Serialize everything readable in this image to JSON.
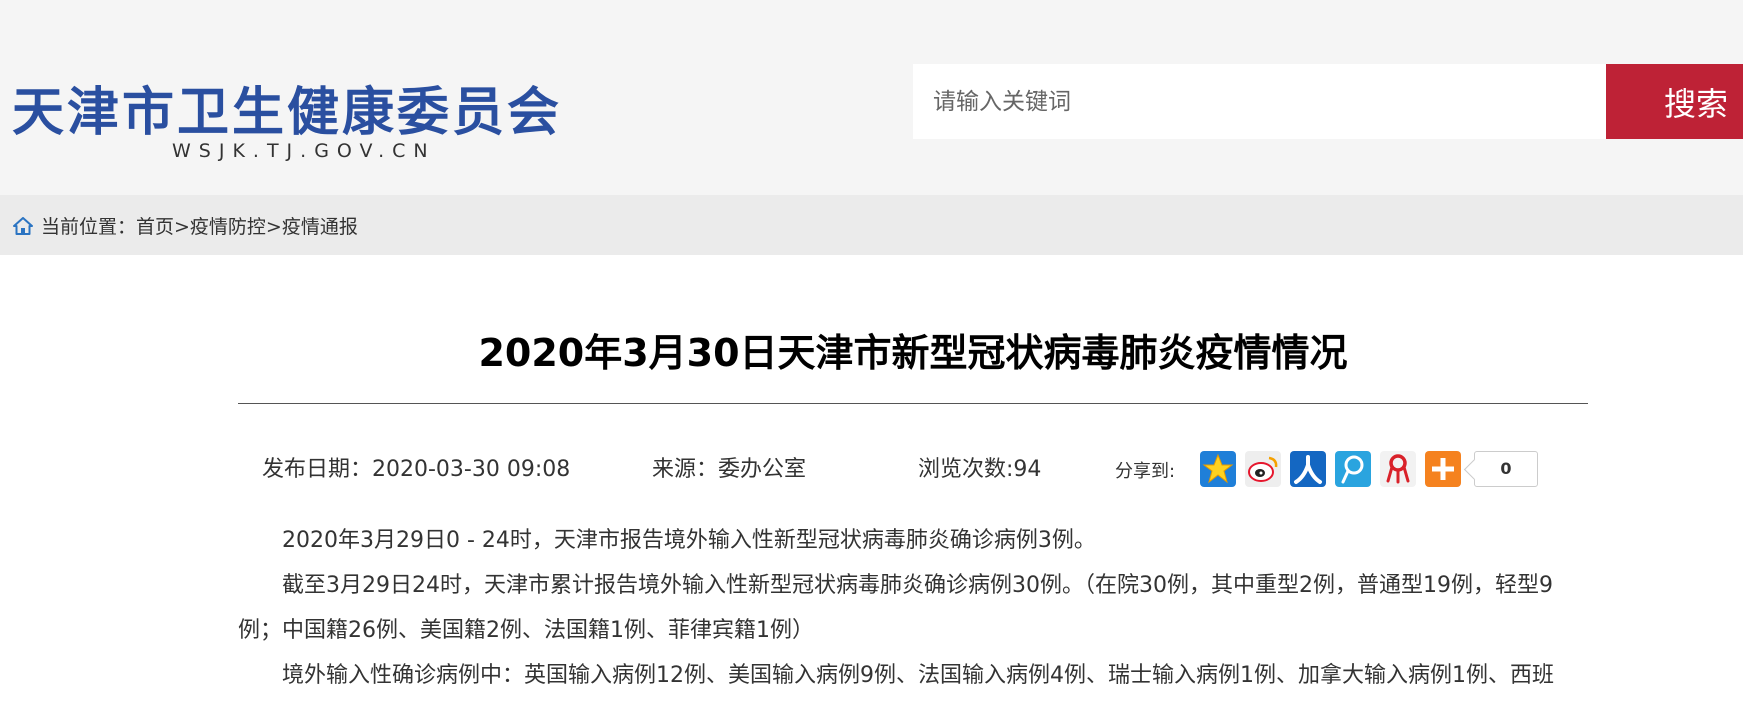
{
  "header": {
    "site_name": "天津市卫生健康委员会",
    "site_domain": "WSJK.TJ.GOV.CN",
    "search_placeholder": "请输入关键词",
    "search_button": "搜索"
  },
  "breadcrumb": {
    "text": "当前位置：首页>疫情防控>疫情通报"
  },
  "article": {
    "title": "2020年3月30日天津市新型冠状病毒肺炎疫情情况",
    "publish_date": "发布日期：2020-03-30 09:08",
    "source": "来源：委办公室",
    "views": "浏览次数:94",
    "share_label": "分享到:",
    "share_count": "0",
    "paragraphs": [
      "2020年3月29日0 - 24时，天津市报告境外输入性新型冠状病毒肺炎确诊病例3例。",
      "截至3月29日24时，天津市累计报告境外输入性新型冠状病毒肺炎确诊病例30例。（在院30例，其中重型2例，普通型19例，轻型9例；中国籍26例、美国籍2例、法国籍1例、菲律宾籍1例）",
      "境外输入性确诊病例中：英国输入病例12例、美国输入病例9例、法国输入病例4例、瑞士输入病例1例、加拿大输入病例1例、西班"
    ]
  },
  "share_icons": [
    {
      "icon": "qzone-star-icon",
      "color": "#1f7fd8"
    },
    {
      "icon": "weibo-icon",
      "color": "#e8e8e8"
    },
    {
      "icon": "renren-icon",
      "color": "#1467c2"
    },
    {
      "icon": "tqq-icon",
      "color": "#2aa4df"
    },
    {
      "icon": "red-ribbon-icon",
      "color": "#f2f2f2"
    },
    {
      "icon": "more-plus-icon",
      "color": "#f5821f"
    }
  ]
}
